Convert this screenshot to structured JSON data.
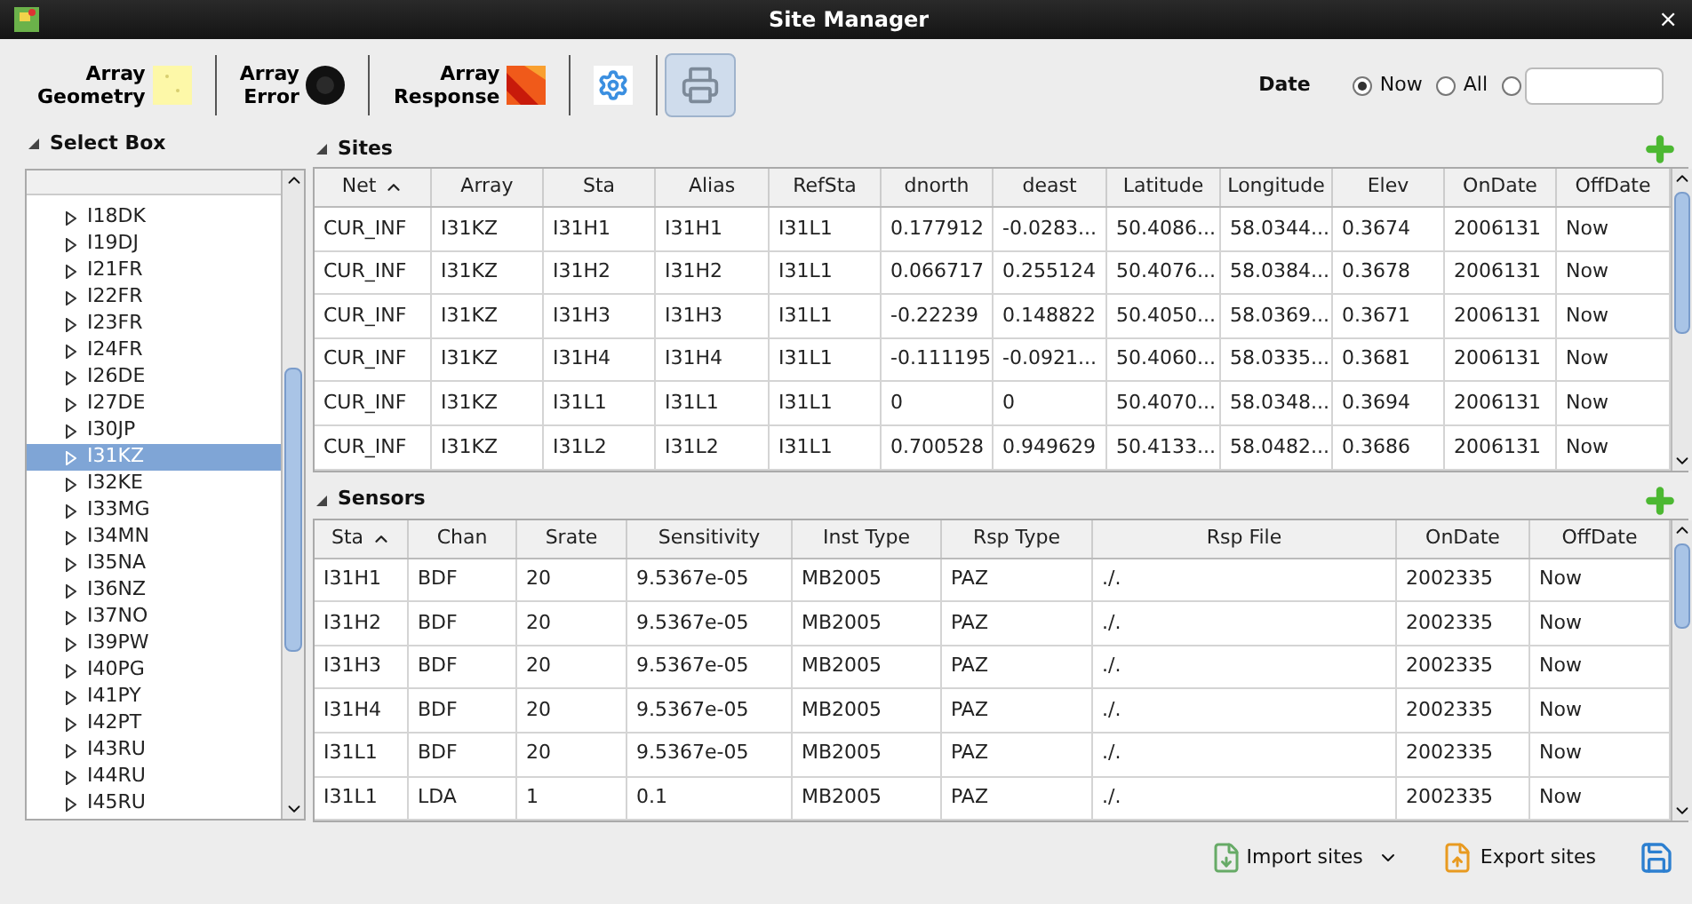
{
  "window": {
    "title": "Site Manager",
    "close": "×"
  },
  "toolbar": [
    {
      "kind": "geometry",
      "label": "Array Geometry",
      "pressed": false
    },
    {
      "kind": "error",
      "label": "Array Error",
      "pressed": false
    },
    {
      "kind": "response",
      "label": "Array Response",
      "pressed": false
    },
    {
      "kind": "settings",
      "pressed": false
    },
    {
      "kind": "print",
      "pressed": true
    }
  ],
  "date": {
    "label": "Date",
    "options": [
      {
        "label": "Now",
        "selected": true
      },
      {
        "label": "All",
        "selected": false
      },
      {
        "selected": false,
        "kind": "custom"
      }
    ]
  },
  "select_box": {
    "title": "Select Box",
    "items": [
      {
        "label": "I18DK",
        "selected": false
      },
      {
        "label": "I19DJ",
        "selected": false
      },
      {
        "label": "I21FR",
        "selected": false
      },
      {
        "label": "I22FR",
        "selected": false
      },
      {
        "label": "I23FR",
        "selected": false
      },
      {
        "label": "I24FR",
        "selected": false
      },
      {
        "label": "I26DE",
        "selected": false
      },
      {
        "label": "I27DE",
        "selected": false
      },
      {
        "label": "I30JP",
        "selected": false
      },
      {
        "label": "I31KZ",
        "selected": true
      },
      {
        "label": "I32KE",
        "selected": false
      },
      {
        "label": "I33MG",
        "selected": false
      },
      {
        "label": "I34MN",
        "selected": false
      },
      {
        "label": "I35NA",
        "selected": false
      },
      {
        "label": "I36NZ",
        "selected": false
      },
      {
        "label": "I37NO",
        "selected": false
      },
      {
        "label": "I39PW",
        "selected": false
      },
      {
        "label": "I40PG",
        "selected": false
      },
      {
        "label": "I41PY",
        "selected": false
      },
      {
        "label": "I42PT",
        "selected": false
      },
      {
        "label": "I43RU",
        "selected": false
      },
      {
        "label": "I44RU",
        "selected": false
      },
      {
        "label": "I45RU",
        "selected": false
      }
    ]
  },
  "sites": {
    "title": "Sites",
    "columns": [
      "Net",
      "Array",
      "Sta",
      "Alias",
      "RefSta",
      "dnorth",
      "deast",
      "Latitude",
      "Longitude",
      "Elev",
      "OnDate",
      "OffDate"
    ],
    "rows": [
      [
        "CUR_INF",
        "I31KZ",
        "I31H1",
        "I31H1",
        "I31L1",
        "0.177912",
        "-0.0283...",
        "50.4086...",
        "58.0344...",
        "0.3674",
        "2006131",
        "Now"
      ],
      [
        "CUR_INF",
        "I31KZ",
        "I31H2",
        "I31H2",
        "I31L1",
        "0.066717",
        "0.255124",
        "50.4076...",
        "58.0384...",
        "0.3678",
        "2006131",
        "Now"
      ],
      [
        "CUR_INF",
        "I31KZ",
        "I31H3",
        "I31H3",
        "I31L1",
        "-0.22239",
        "0.148822",
        "50.4050...",
        "58.0369...",
        "0.3671",
        "2006131",
        "Now"
      ],
      [
        "CUR_INF",
        "I31KZ",
        "I31H4",
        "I31H4",
        "I31L1",
        "-0.111195",
        "-0.0921...",
        "50.4060...",
        "58.0335...",
        "0.3681",
        "2006131",
        "Now"
      ],
      [
        "CUR_INF",
        "I31KZ",
        "I31L1",
        "I31L1",
        "I31L1",
        "0",
        "0",
        "50.4070...",
        "58.0348...",
        "0.3694",
        "2006131",
        "Now"
      ],
      [
        "CUR_INF",
        "I31KZ",
        "I31L2",
        "I31L2",
        "I31L1",
        "0.700528",
        "0.949629",
        "50.4133...",
        "58.0482...",
        "0.3686",
        "2006131",
        "Now"
      ]
    ]
  },
  "sensors": {
    "title": "Sensors",
    "columns": [
      "Sta",
      "Chan",
      "Srate",
      "Sensitivity",
      "Inst Type",
      "Rsp Type",
      "Rsp File",
      "OnDate",
      "OffDate"
    ],
    "rows": [
      [
        "I31H1",
        "BDF",
        "20",
        "9.5367e-05",
        "MB2005",
        "PAZ",
        "./.",
        "2002335",
        "Now"
      ],
      [
        "I31H2",
        "BDF",
        "20",
        "9.5367e-05",
        "MB2005",
        "PAZ",
        "./.",
        "2002335",
        "Now"
      ],
      [
        "I31H3",
        "BDF",
        "20",
        "9.5367e-05",
        "MB2005",
        "PAZ",
        "./.",
        "2002335",
        "Now"
      ],
      [
        "I31H4",
        "BDF",
        "20",
        "9.5367e-05",
        "MB2005",
        "PAZ",
        "./.",
        "2002335",
        "Now"
      ],
      [
        "I31L1",
        "BDF",
        "20",
        "9.5367e-05",
        "MB2005",
        "PAZ",
        "./.",
        "2002335",
        "Now"
      ],
      [
        "I31L1",
        "LDA",
        "1",
        "0.1",
        "MB2005",
        "PAZ",
        "./.",
        "2002335",
        "Now"
      ]
    ]
  },
  "footer": {
    "import": "Import sites",
    "export": "Export sites"
  }
}
